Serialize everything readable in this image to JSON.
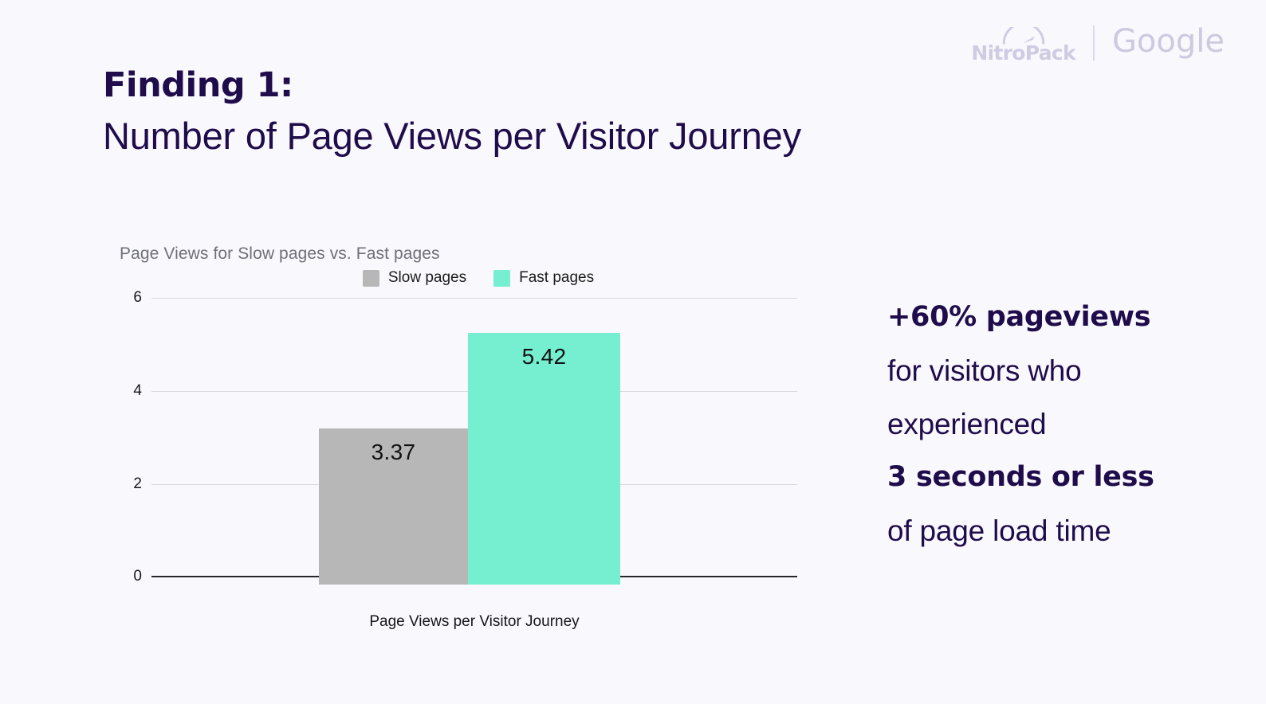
{
  "brand": {
    "nitropack_name": "NitroPack",
    "nitropack_icon": "speedometer-gauge-icon",
    "divider": "|",
    "google_name": "Google"
  },
  "heading": {
    "finding_label": "Finding 1:",
    "finding_title": "Number of Page Views per Visitor Journey"
  },
  "callout": {
    "line1": "+60% pageviews",
    "line2": "for visitors who",
    "line3": "experienced",
    "line4": "3 seconds or less",
    "line5": "of page load time"
  },
  "colors": {
    "background": "#f9f8fd",
    "brand_navy": "#1f0c4b",
    "slow_bar": "#b7b7b7",
    "fast_bar": "#75efd0",
    "logo_gray": "#cdc9df",
    "gridline": "#d7d7dc",
    "axis": "#26262b"
  },
  "chart_data": {
    "type": "bar",
    "title": "Page Views for Slow pages vs. Fast pages",
    "xlabel": "Page Views per Visitor Journey",
    "ylabel": "",
    "categories": [
      "Page Views per Visitor Journey"
    ],
    "series": [
      {
        "name": "Slow pages",
        "values": [
          3.37
        ],
        "color": "#b7b7b7"
      },
      {
        "name": "Fast pages",
        "values": [
          5.42
        ],
        "color": "#75efd0"
      }
    ],
    "data_labels": [
      "3.37",
      "5.42"
    ],
    "ylim": [
      0,
      6
    ],
    "yticks": [
      0,
      2,
      4,
      6
    ],
    "ytick_labels": [
      "0",
      "2",
      "4",
      "6"
    ],
    "grid": true,
    "legend": {
      "position": "top-center",
      "entries": [
        {
          "label": "Slow pages",
          "color": "#b7b7b7"
        },
        {
          "label": "Fast pages",
          "color": "#75efd0"
        }
      ]
    }
  }
}
